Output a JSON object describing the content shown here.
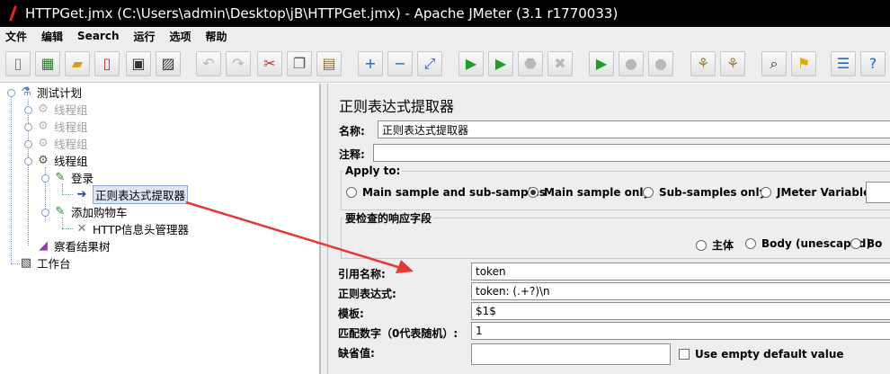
{
  "window": {
    "title": "HTTPGet.jmx (C:\\Users\\admin\\Desktop\\jB\\HTTPGet.jmx) - Apache JMeter (3.1 r1770033)"
  },
  "menubar": {
    "items": [
      "文件",
      "编辑",
      "Search",
      "运行",
      "选项",
      "帮助"
    ]
  },
  "toolbar": {
    "icons": [
      "new-icon",
      "templates-icon",
      "open-icon",
      "close-icon",
      "save-icon",
      "save-as-icon",
      "undo-icon",
      "redo-icon",
      "cut-icon",
      "copy-icon",
      "paste-icon",
      "expand-icon",
      "collapse-icon",
      "toggle-icon",
      "start-icon",
      "start-no-pause-icon",
      "stop-icon",
      "shutdown-icon",
      "remote-start-icon",
      "remote-stop-icon",
      "remote-shutdown-icon",
      "clear-icon",
      "clear-all-icon",
      "search-icon",
      "reset-search-icon",
      "function-helper-icon",
      "help-icon"
    ]
  },
  "tree": {
    "root": "测试计划",
    "thread_groups": [
      "线程组",
      "线程组",
      "线程组",
      "线程组"
    ],
    "sampler_login": "登录",
    "regex_extractor": "正则表达式提取器",
    "sampler_cart": "添加购物车",
    "header_manager": "HTTP信息头管理器",
    "results_tree": "察看结果树",
    "workbench": "工作台"
  },
  "panel": {
    "title": "正则表达式提取器",
    "name_label": "名称:",
    "name_value": "正则表达式提取器",
    "comment_label": "注释:",
    "comment_value": "",
    "apply_to": {
      "legend": "Apply to:",
      "options": [
        "Main sample and sub-samples",
        "Main sample only",
        "Sub-samples only",
        "JMeter Variable"
      ],
      "selected": "Main sample only",
      "variable_value": ""
    },
    "response_field": {
      "legend": "要检查的响应字段",
      "options": [
        "主体",
        "Body (unescaped)",
        "Bo"
      ]
    },
    "ref_name_label": "引用名称:",
    "ref_name_value": "token",
    "regex_label": "正则表达式:",
    "regex_value": "token: (.+?)\\n",
    "template_label": "模板:",
    "template_value": "$1$",
    "match_no_label": "匹配数字（0代表随机）:",
    "match_no_value": "1",
    "default_label": "缺省值:",
    "default_value": "",
    "use_empty_label": "Use empty default value"
  },
  "colors": {
    "annotation_arrow": "#e53935",
    "selection": "#dbe6f5"
  }
}
